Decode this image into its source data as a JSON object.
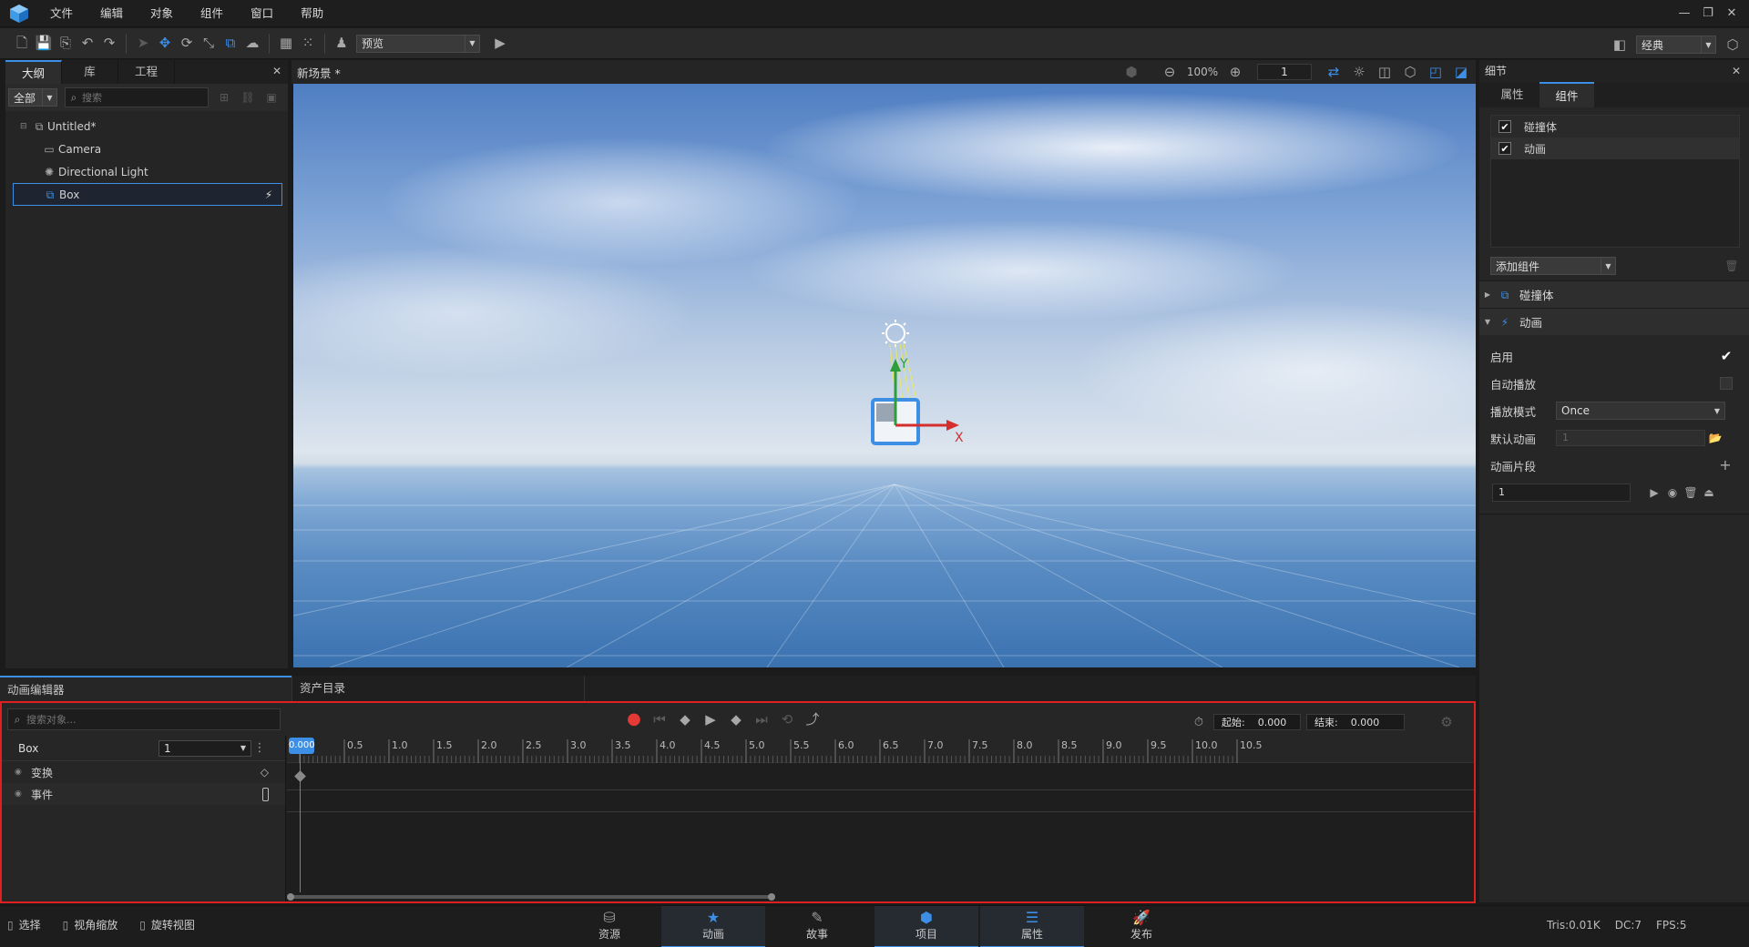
{
  "menu": {
    "items": [
      "文件",
      "编辑",
      "对象",
      "组件",
      "窗口",
      "帮助"
    ]
  },
  "window_controls": {
    "minimize": "—",
    "restore": "❐",
    "close": "✕"
  },
  "toolbar": {
    "preview_label": "预览",
    "layout_label": "经典"
  },
  "outline": {
    "tabs": [
      "大纲",
      "库",
      "工程"
    ],
    "filter_label": "全部",
    "search_placeholder": "搜索",
    "tree": [
      "Untitled*",
      "Camera",
      "Directional Light",
      "Box"
    ]
  },
  "scene": {
    "tab_title": "新场景 *",
    "zoom": "100%",
    "layer": "1"
  },
  "gizmo": {
    "y_label": "Y",
    "x_label": "X"
  },
  "details": {
    "title": "细节",
    "tabs": [
      "属性",
      "组件"
    ],
    "component_list": [
      "碰撞体",
      "动画"
    ],
    "add_component_label": "添加组件",
    "section_collider": "碰撞体",
    "section_animation": "动画",
    "enable_label": "启用",
    "enable_checked": true,
    "autoplay_label": "自动播放",
    "autoplay_checked": false,
    "playmode_label": "播放模式",
    "playmode_value": "Once",
    "default_anim_label": "默认动画",
    "default_anim_value": "1",
    "clips_label": "动画片段",
    "clip_value": "1"
  },
  "bottom_tabs": [
    "动画编辑器",
    "资产目录"
  ],
  "anim_editor": {
    "search_placeholder": "搜索对象...",
    "start_label": "起始:",
    "start_value": "0.000",
    "end_label": "结束:",
    "end_value": "0.000",
    "object_name": "Box",
    "clip_select": "1",
    "tracks": [
      "变换",
      "事件"
    ],
    "playhead_value": "0.000",
    "ruler_ticks": [
      "0.5",
      "1.0",
      "1.5",
      "2.0",
      "2.5",
      "3.0",
      "3.5",
      "4.0",
      "4.5",
      "5.0",
      "5.5",
      "6.0",
      "6.5",
      "7.0",
      "7.5",
      "8.0",
      "8.5",
      "9.0",
      "9.5",
      "10.0",
      "10.5"
    ]
  },
  "statusbar": {
    "tools": [
      "选择",
      "视角缩放",
      "旋转视图"
    ],
    "nav": [
      "资源",
      "动画",
      "故事",
      "项目",
      "属性",
      "发布"
    ],
    "nav_active": [
      "动画",
      "项目",
      "属性"
    ],
    "tris": "Tris:0.01K",
    "dc": "DC:7",
    "fps": "FPS:5"
  },
  "colors": {
    "accent": "#3d8fe6",
    "highlight_border": "#e02020",
    "record": "#e53935",
    "axis_x": "#d32f2f",
    "axis_y": "#2e9e3a"
  }
}
